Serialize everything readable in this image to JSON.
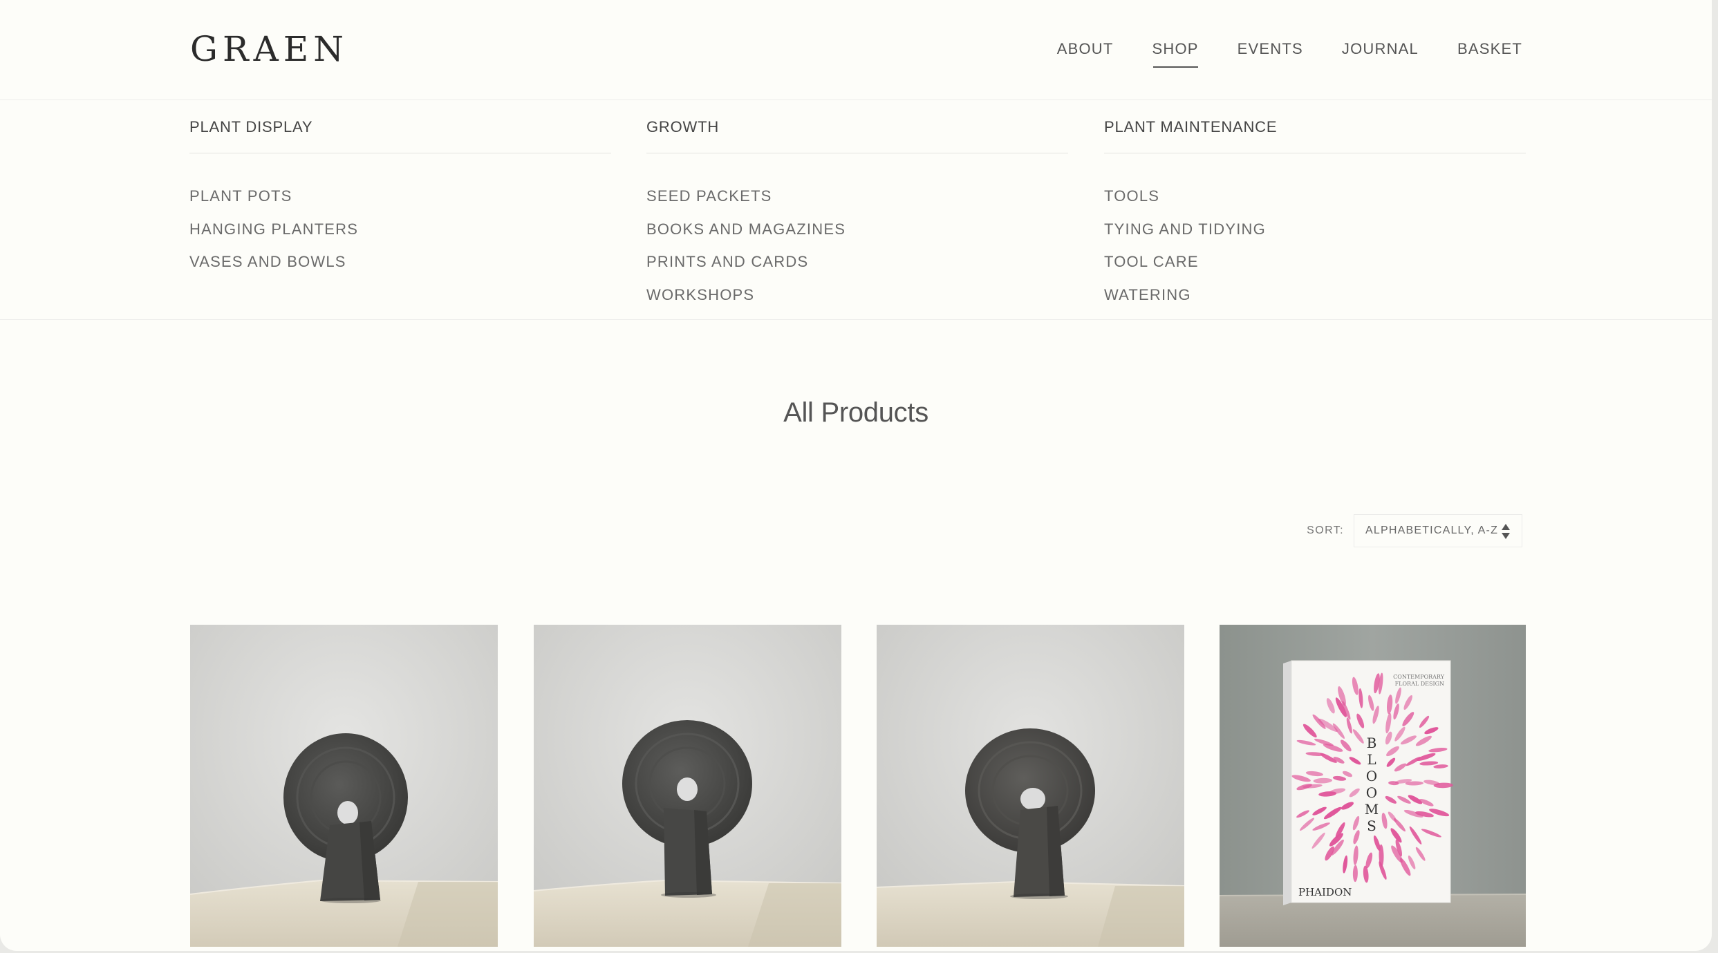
{
  "brand": {
    "logo_text": "GRAEN"
  },
  "nav": {
    "items": [
      {
        "label": "ABOUT",
        "active": false
      },
      {
        "label": "SHOP",
        "active": true
      },
      {
        "label": "EVENTS",
        "active": false
      },
      {
        "label": "JOURNAL",
        "active": false
      },
      {
        "label": "BASKET",
        "active": false
      }
    ]
  },
  "mega_menu": {
    "columns": [
      {
        "title": "PLANT DISPLAY",
        "links": [
          "PLANT POTS",
          "HANGING PLANTERS",
          "VASES AND BOWLS"
        ]
      },
      {
        "title": "GROWTH",
        "links": [
          "SEED PACKETS",
          "BOOKS AND MAGAZINES",
          "PRINTS AND CARDS",
          "WORKSHOPS"
        ]
      },
      {
        "title": "PLANT MAINTENANCE",
        "links": [
          "TOOLS",
          "TYING AND TIDYING",
          "TOOL CARE",
          "WATERING"
        ]
      }
    ]
  },
  "main": {
    "title": "All Products",
    "sort": {
      "label": "SORT:",
      "value": "ALPHABETICALLY, A-Z"
    }
  },
  "products": {
    "book": {
      "brand": "PHAIDON",
      "title_letters": [
        "B",
        "L",
        "O",
        "O",
        "M",
        "S"
      ],
      "subtitle_1": "CONTEMPORARY",
      "subtitle_2": "FLORAL DESIGN"
    }
  },
  "colors": {
    "background": "#fdfdf9",
    "text": "#555555",
    "vase": "#4a4a48",
    "petal_pink": "#e0569a"
  }
}
